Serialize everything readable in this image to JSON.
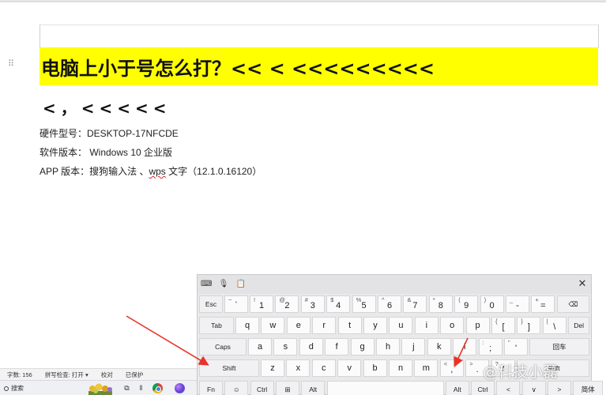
{
  "document": {
    "heading": "电脑上小于号怎么打？<< < <<<<<<<<<",
    "subheading": "<，<<<<<",
    "lines": {
      "hardware": "硬件型号：DESKTOP-17NFCDE",
      "software": "软件版本： Windows 10  企业版",
      "app_prefix": "APP 版本：搜狗输入法 、",
      "app_wps": "wps",
      "app_suffix": " 文字（12.1.0.16120）"
    }
  },
  "statusbar": {
    "word_count": "字数: 156",
    "spell_check": "拼写检查: 打开 ▾",
    "proofread": "校对",
    "protected": "已保护"
  },
  "taskbar": {
    "search_label": "搜索"
  },
  "keyboard": {
    "close_label": "✕",
    "row1": [
      {
        "sec": "~",
        "pri": "`",
        "label": "Esc",
        "fn": true
      },
      {
        "sec": "~ `",
        "pri": ""
      },
      {
        "sec": "!",
        "pri": "1"
      },
      {
        "sec": "@",
        "pri": "2"
      },
      {
        "sec": "#",
        "pri": "3"
      },
      {
        "sec": "$",
        "pri": "4"
      },
      {
        "sec": "%",
        "pri": "5"
      },
      {
        "sec": "^",
        "pri": "6"
      },
      {
        "sec": "&",
        "pri": "7"
      },
      {
        "sec": "*",
        "pri": "8"
      },
      {
        "sec": "(",
        "pri": "9"
      },
      {
        "sec": ")",
        "pri": "0"
      },
      {
        "sec": "_",
        "pri": "-"
      },
      {
        "sec": "+",
        "pri": "="
      },
      {
        "pri": "⌫"
      }
    ],
    "row2": [
      "Tab",
      "q",
      "w",
      "e",
      "r",
      "t",
      "y",
      "u",
      "i",
      "o",
      "p",
      "[",
      "]",
      "\\",
      "Del"
    ],
    "row2_sec": {
      "[": "{",
      "]": "}",
      "\\": "|"
    },
    "row3": [
      "Caps",
      "a",
      "s",
      "d",
      "f",
      "g",
      "h",
      "j",
      "k",
      "l",
      ";",
      "'",
      "回车"
    ],
    "row3_sec": {
      ";": ":",
      "'": "\""
    },
    "row4": [
      "Shift",
      "z",
      "x",
      "c",
      "v",
      "b",
      "n",
      "m",
      ",",
      ".",
      "/",
      "Shift"
    ],
    "row4_sec": {
      ",": "<",
      ".": ">",
      "/": "?"
    },
    "row5": [
      "Fn",
      "☺",
      "Ctrl",
      "⊞",
      "Alt",
      "",
      "Alt",
      "Ctrl",
      "<",
      "∨",
      ">",
      "简体"
    ]
  },
  "watermark": "@科技小磊",
  "colors": {
    "heading_highlight": "#ffff00",
    "arrow": "#e8332a",
    "keyboard_bg": "#e9e9ea",
    "key_bg": "#fbfbfb"
  }
}
